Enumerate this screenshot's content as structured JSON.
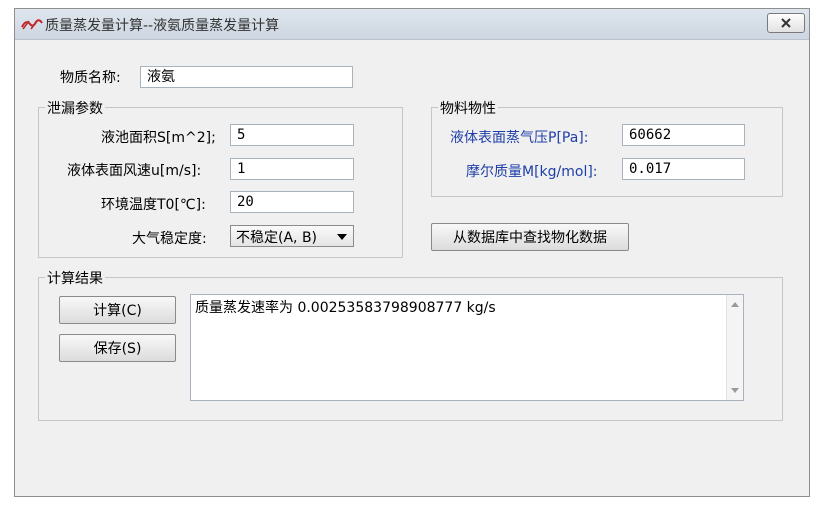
{
  "window": {
    "title": "质量蒸发量计算--液氨质量蒸发量计算",
    "close_icon": "close-icon",
    "app_icon": "app-logo-icon"
  },
  "substance": {
    "label": "物质名称:",
    "value": "液氨"
  },
  "leak_params": {
    "title": "泄漏参数",
    "pool_area_label": "液池面积S[m^2];",
    "pool_area_value": "5",
    "wind_speed_label": "液体表面风速u[m/s]:",
    "wind_speed_value": "1",
    "temp_label": "环境温度T0[℃]:",
    "temp_value": "20",
    "stability_label": "大气稳定度:",
    "stability_value": "不稳定(A, B)"
  },
  "material_props": {
    "title": "物料物性",
    "vapor_pressure_label": "液体表面蒸气压P[Pa]:",
    "vapor_pressure_value": "60662",
    "molar_mass_label": "摩尔质量M[kg/mol]:",
    "molar_mass_value": "0.017",
    "lookup_button": "从数据库中查找物化数据",
    "label_color": "#1f3fa8"
  },
  "results": {
    "title": "计算结果",
    "calc_button": "计算(C)",
    "save_button": "保存(S)",
    "output_text": "质量蒸发速率为 0.00253583798908777 kg/s"
  }
}
